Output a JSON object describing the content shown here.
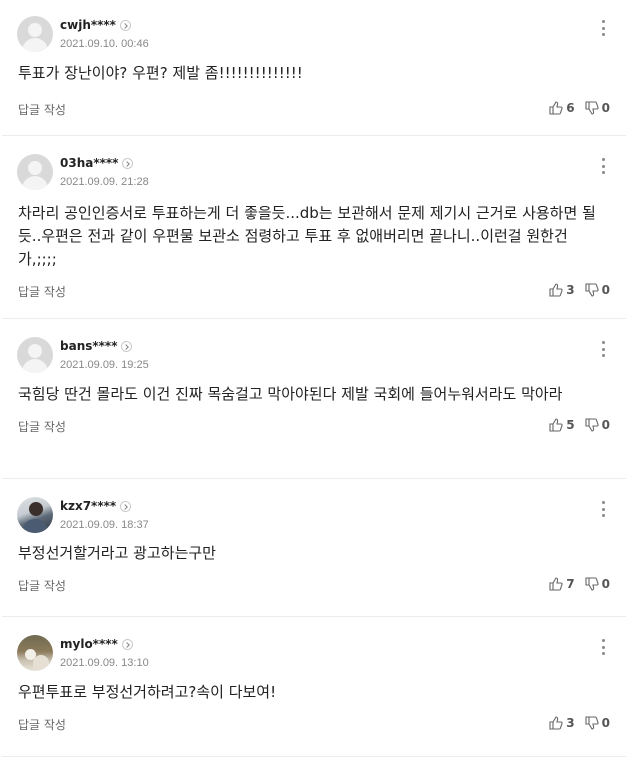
{
  "comments": [
    {
      "nick": "cwjh****",
      "date": "2021.09.10. 00:46",
      "text": "투표가 장난이야? 우편? 제발 좀!!!!!!!!!!!!!!",
      "reply": "답글 작성",
      "likes": "6",
      "dislikes": "0",
      "avatar": "default"
    },
    {
      "nick": "03ha****",
      "date": "2021.09.09. 21:28",
      "text": "차라리 공인인증서로 투표하는게 더 좋을듯...db는 보관해서 문제 제기시 근거로 사용하면 될듯..우편은 전과 같이 우편물 보관소 점령하고 투표 후 없애버리면 끝나니..이런걸 원한건가,;;;;",
      "reply": "답글 작성",
      "likes": "3",
      "dislikes": "0",
      "avatar": "default"
    },
    {
      "nick": "bans****",
      "date": "2021.09.09. 19:25",
      "text": "국힘당 딴건 몰라도 이건 진짜 목숨걸고 막아야된다 제발 국회에 들어누워서라도 막아라",
      "reply": "답글 작성",
      "likes": "5",
      "dislikes": "0",
      "avatar": "default"
    },
    {
      "nick": "kzx7****",
      "date": "2021.09.09. 18:37",
      "text": "부정선거할거라고 광고하는구만",
      "reply": "답글 작성",
      "likes": "7",
      "dislikes": "0",
      "avatar": "photo1"
    },
    {
      "nick": "mylo****",
      "date": "2021.09.09. 13:10",
      "text": "우편투표로 부정선거하려고?속이 다보여!",
      "reply": "답글 작성",
      "likes": "3",
      "dislikes": "0",
      "avatar": "photo2"
    }
  ]
}
